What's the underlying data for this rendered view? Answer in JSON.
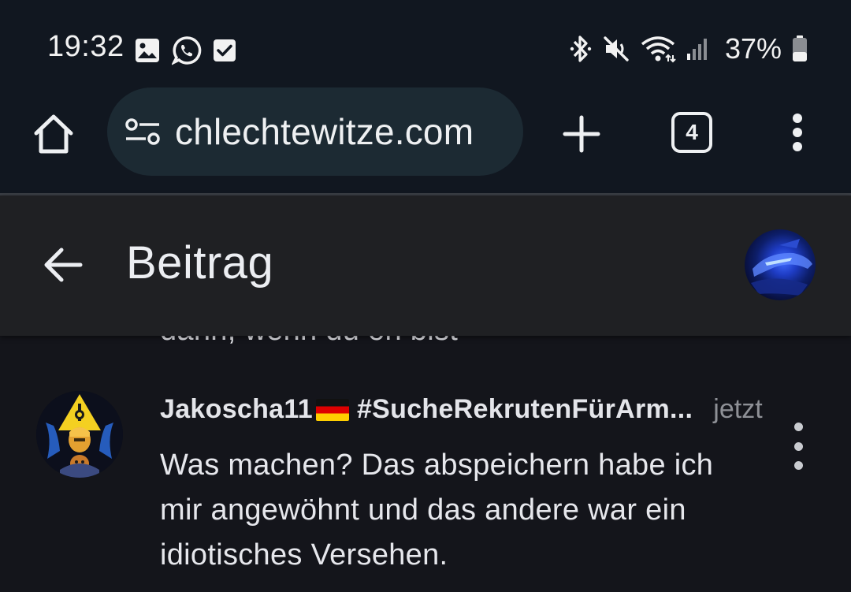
{
  "status_bar": {
    "time": "19:32",
    "left_icons": [
      "image-icon",
      "whatsapp-icon",
      "checkbox-icon"
    ],
    "right_icons": [
      "bluetooth-icon",
      "mute-icon",
      "wifi-icon",
      "cell-signal-icon",
      "battery-icon"
    ],
    "battery_percent": "37%"
  },
  "browser": {
    "url": "chlechtewitze.com",
    "tab_count": "4"
  },
  "header": {
    "title": "Beitrag"
  },
  "previous_comment": {
    "tail_text": "dann, wenn du on bist"
  },
  "comment": {
    "author": "Jakoscha11",
    "tag": "#SucheRekrutenFürArm...",
    "timestamp": "jetzt",
    "body": "Was machen? Das abspeichern habe ich mir angewöhnt und das andere war ein idiotisches Versehen."
  },
  "colors": {
    "background": "#14151b",
    "topbar": "#111720",
    "url_pill": "#1c2a33",
    "header": "#1f2023",
    "muted_text": "#8e9096"
  }
}
